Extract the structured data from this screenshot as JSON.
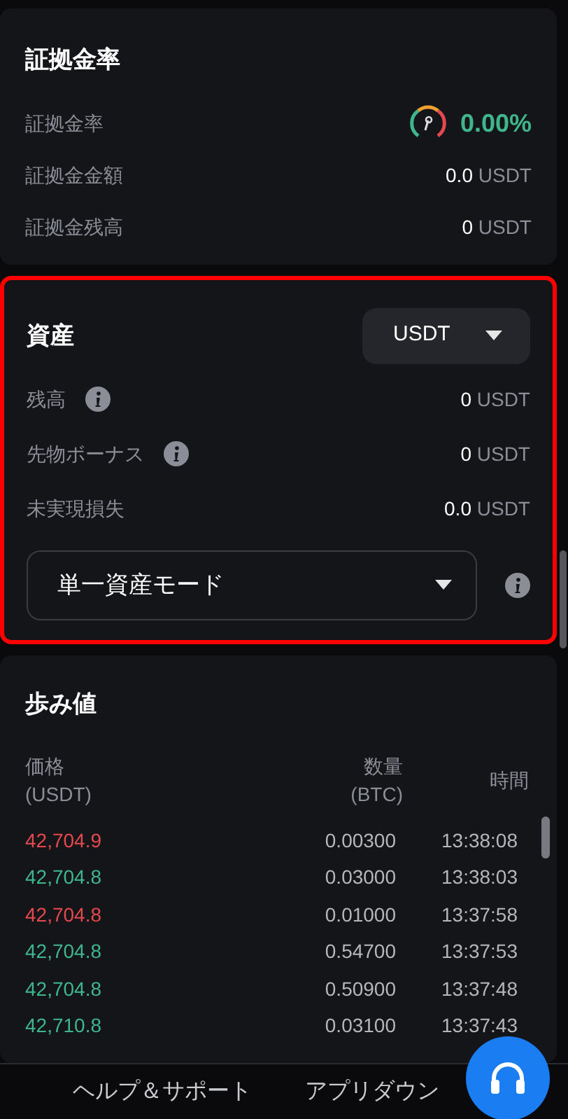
{
  "margin": {
    "title": "証拠金率",
    "rows": [
      {
        "kind": "ratio",
        "label": "証拠金率",
        "value": "0.00%"
      },
      {
        "kind": "amount",
        "label": "証拠金金額",
        "value": "0.0",
        "unit": "USDT"
      },
      {
        "kind": "amount",
        "label": "証拠金残高",
        "value": "0",
        "unit": "USDT"
      }
    ]
  },
  "assets": {
    "title": "資産",
    "highlighted": true,
    "currency": "USDT",
    "rows": [
      {
        "label": "残高",
        "info": true,
        "value": "0",
        "unit": "USDT"
      },
      {
        "label": "先物ボーナス",
        "info": true,
        "value": "0",
        "unit": "USDT"
      },
      {
        "label": "未実現損失",
        "info": false,
        "value": "0.0",
        "unit": "USDT"
      }
    ],
    "mode": "単一資産モード"
  },
  "trades": {
    "title": "歩み値",
    "columns": [
      {
        "label": "価格",
        "sub": "(USDT)"
      },
      {
        "label": "数量",
        "sub": "(BTC)"
      },
      {
        "label": "時間"
      }
    ],
    "rows": [
      {
        "color": "#e5484d",
        "price": "42,704.9",
        "qty": "0.00300",
        "time": "13:38:08"
      },
      {
        "color": "#3fb68b",
        "price": "42,704.8",
        "qty": "0.03000",
        "time": "13:38:03"
      },
      {
        "color": "#e5484d",
        "price": "42,704.8",
        "qty": "0.01000",
        "time": "13:37:58"
      },
      {
        "color": "#3fb68b",
        "price": "42,704.8",
        "qty": "0.54700",
        "time": "13:37:53"
      },
      {
        "color": "#3fb68b",
        "price": "42,704.8",
        "qty": "0.50900",
        "time": "13:37:48"
      },
      {
        "color": "#3fb68b",
        "price": "42,710.8",
        "qty": "0.03100",
        "time": "13:37:43"
      }
    ]
  },
  "footer": {
    "links": [
      "ヘルプ＆サポート",
      "アプリダウン"
    ]
  }
}
